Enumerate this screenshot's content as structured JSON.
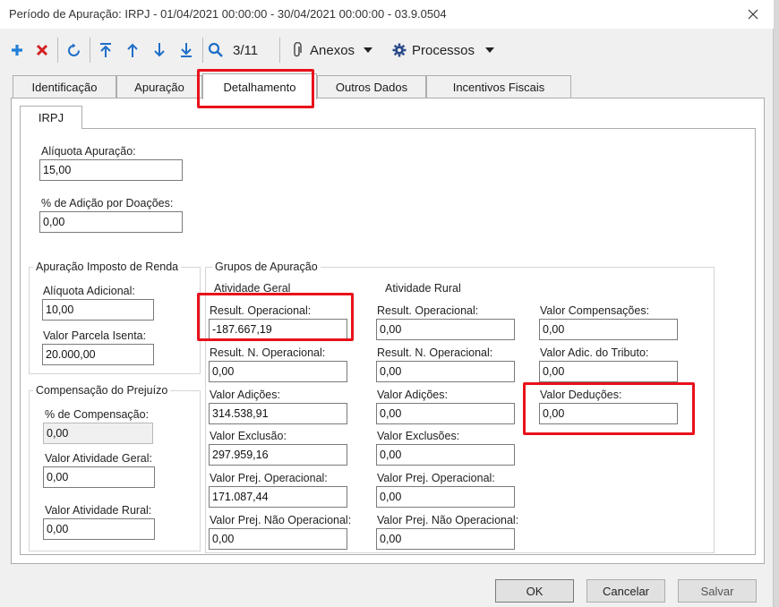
{
  "window": {
    "title": "Período de Apuração: IRPJ - 01/04/2021 00:00:00 - 30/04/2021 00:00:00 - 03.9.0504"
  },
  "toolbar": {
    "record_counter": "3/11",
    "attachments_label": "Anexos",
    "processes_label": "Processos"
  },
  "tabs": [
    "Identificação",
    "Apuração",
    "Detalhamento",
    "Outros Dados",
    "Incentivos Fiscais"
  ],
  "subtab": "IRPJ",
  "top_fields": {
    "aliquota_label": "Alíquota Apuração:",
    "aliquota_value": "15,00",
    "adicao_label": "% de Adição por Doações:",
    "adicao_value": "0,00"
  },
  "imposto_renda": {
    "title": "Apuração Imposto de Renda",
    "aliquota_adicional_label": "Alíquota Adicional:",
    "aliquota_adicional_value": "10,00",
    "parcela_isenta_label": "Valor Parcela Isenta:",
    "parcela_isenta_value": "20.000,00"
  },
  "compensacao": {
    "title": "Compensação do Prejuízo",
    "percentual_label": "% de Compensação:",
    "percentual_value": "0,00",
    "geral_label": "Valor Atividade Geral:",
    "geral_value": "0,00",
    "rural_label": "Valor Atividade Rural:",
    "rural_value": "0,00"
  },
  "grupos": {
    "title": "Grupos de Apuração",
    "geral": {
      "title": "Atividade Geral",
      "fields": [
        {
          "label": "Result. Operacional:",
          "value": "-187.667,19"
        },
        {
          "label": "Result. N. Operacional:",
          "value": "0,00"
        },
        {
          "label": "Valor Adições:",
          "value": "314.538,91"
        },
        {
          "label": "Valor Exclusão:",
          "value": "297.959,16"
        },
        {
          "label": "Valor Prej. Operacional:",
          "value": "171.087,44"
        },
        {
          "label": "Valor Prej. Não Operacional:",
          "value": "0,00"
        }
      ]
    },
    "rural": {
      "title": "Atividade Rural",
      "fields": [
        {
          "label": "Result. Operacional:",
          "value": "0,00"
        },
        {
          "label": "Result. N. Operacional:",
          "value": "0,00"
        },
        {
          "label": "Valor Adições:",
          "value": "0,00"
        },
        {
          "label": "Valor Exclusões:",
          "value": "0,00"
        },
        {
          "label": "Valor Prej. Operacional:",
          "value": "0,00"
        },
        {
          "label": "Valor Prej. Não Operacional:",
          "value": "0,00"
        }
      ]
    },
    "extra": {
      "fields": [
        {
          "label": "Valor Compensações:",
          "value": "0,00"
        },
        {
          "label": "Valor Adic. do Tributo:",
          "value": "0,00"
        },
        {
          "label": "Valor Deduções:",
          "value": "0,00"
        }
      ]
    }
  },
  "buttons": {
    "ok": "OK",
    "cancel": "Cancelar",
    "save": "Salvar"
  },
  "colors": {
    "highlight": "#e8111b",
    "add_icon": "#1e7fd8",
    "delete_icon": "#d42020",
    "nav_icon": "#1e6fc8"
  }
}
